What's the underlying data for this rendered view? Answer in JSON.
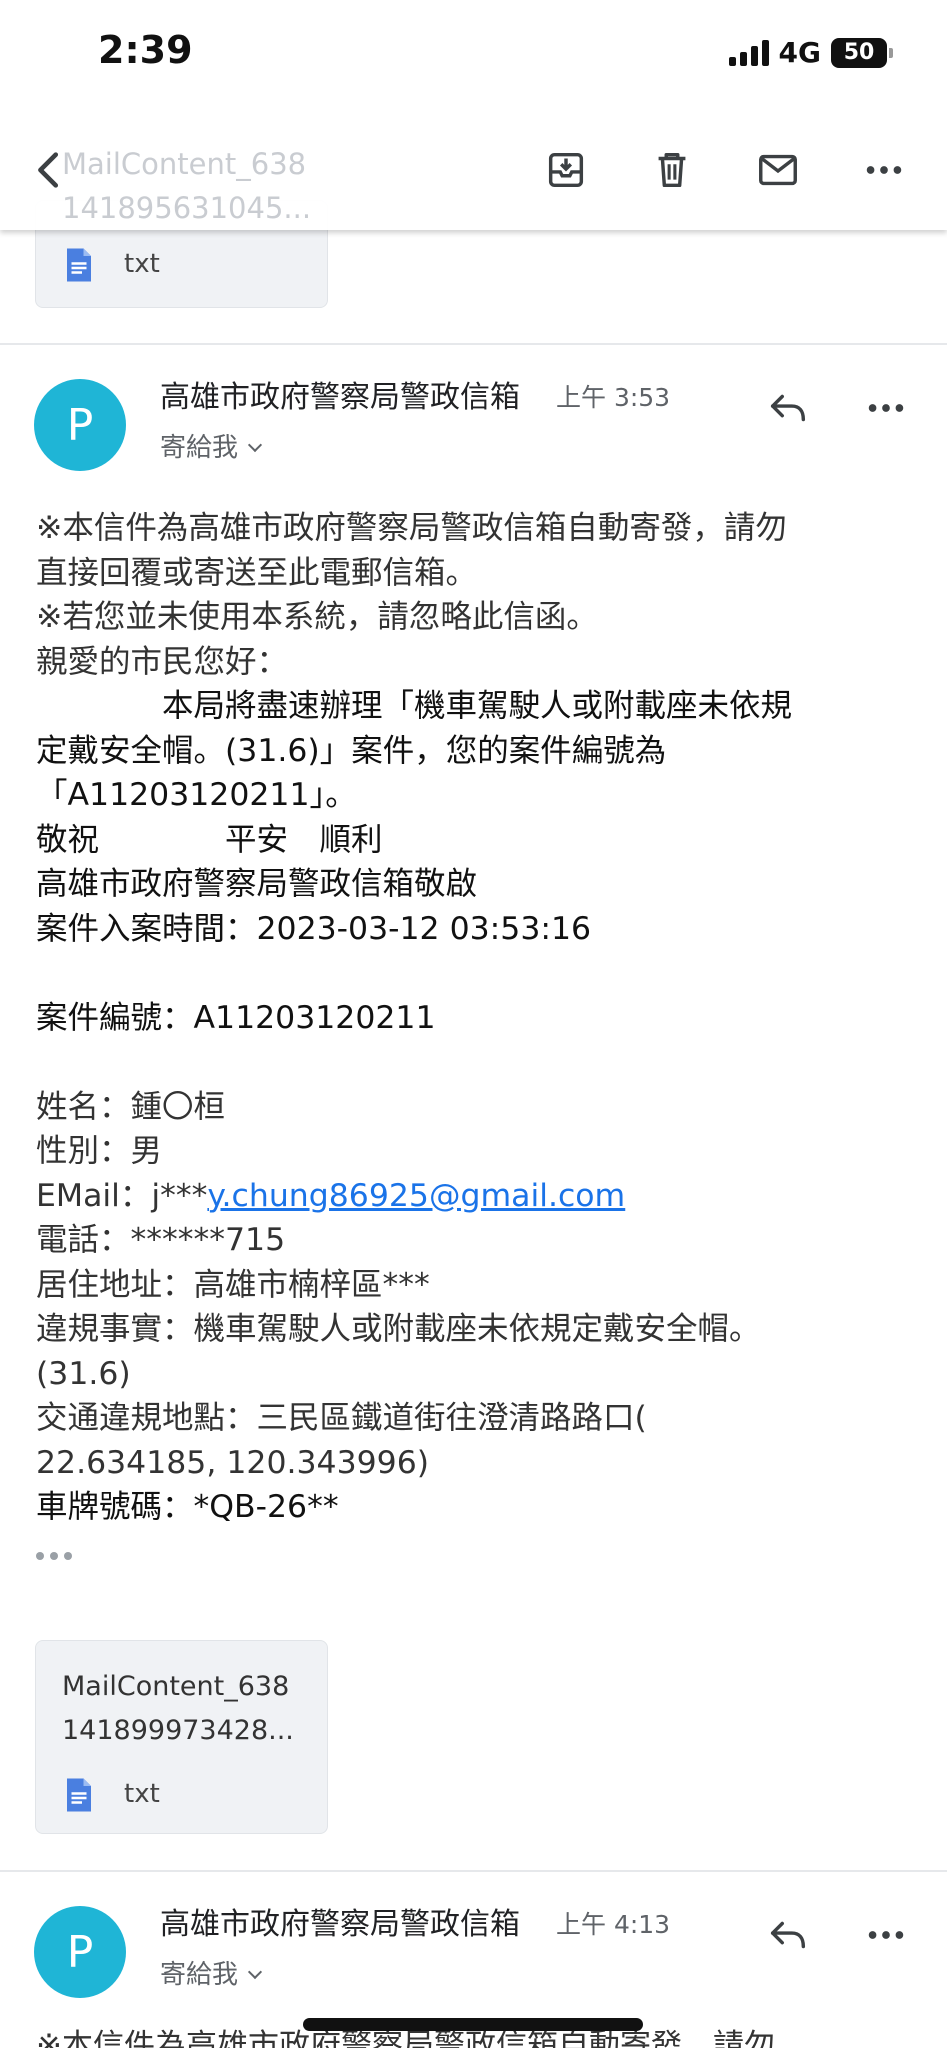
{
  "status_bar": {
    "time": "2:39",
    "network": "4G",
    "battery": "50"
  },
  "toolbar": {
    "ghost_title_line1": "MailContent_638",
    "ghost_title_line2": "141895631045...",
    "icons": [
      "back-arrow-icon",
      "archive-icon",
      "trash-icon",
      "mail-icon",
      "more-icon"
    ]
  },
  "attachment_top": {
    "type": "txt"
  },
  "message1": {
    "avatar_letter": "P",
    "sender": "高雄市政府警察局警政信箱",
    "time": "上午 3:53",
    "to": "寄給我",
    "lines": [
      "※本信件為高雄市政府警察局警政信箱自動寄發，請勿",
      "直接回覆或寄送至此電郵信箱。",
      "※若您並未使用本系統，請忽略此信函。",
      "親愛的市民您好：",
      "　　　　本局將盡速辦理「機車駕駛人或附載座未依規",
      "定戴安全帽。(31.6)」案件，您的案件編號為",
      "「A11203120211」。",
      "  敬祝　　　　平安　順利",
      "高雄市政府警察局警政信箱敬啟",
      "案件入案時間：2023-03-12 03:53:16"
    ],
    "case_number_line": "案件編號：A11203120211",
    "details": {
      "name": "姓名：鍾〇桓",
      "gender": "性別：男",
      "email_label": "EMail：j***",
      "email_link": "y.chung86925@gmail.com",
      "phone": "電話：******715",
      "address": "居住地址：高雄市楠梓區***",
      "violation_1": "違規事實：機車駕駛人或附載座未依規定戴安全帽。",
      "violation_2": "(31.6)",
      "location_1": "交通違規地點：三民區鐵道街往澄清路路口(",
      "location_2": "22.634185, 120.343996)",
      "plate": "車牌號碼：*QB-26**"
    }
  },
  "attachment": {
    "name_line1": "MailContent_638",
    "name_line2": "141899973428...",
    "type": "txt"
  },
  "message2": {
    "avatar_letter": "P",
    "sender": "高雄市政府警察局警政信箱",
    "time": "上午 4:13",
    "to": "寄給我",
    "first_line": "※本信件為高雄市政府警察局警政信箱自動寄發，請勿"
  }
}
